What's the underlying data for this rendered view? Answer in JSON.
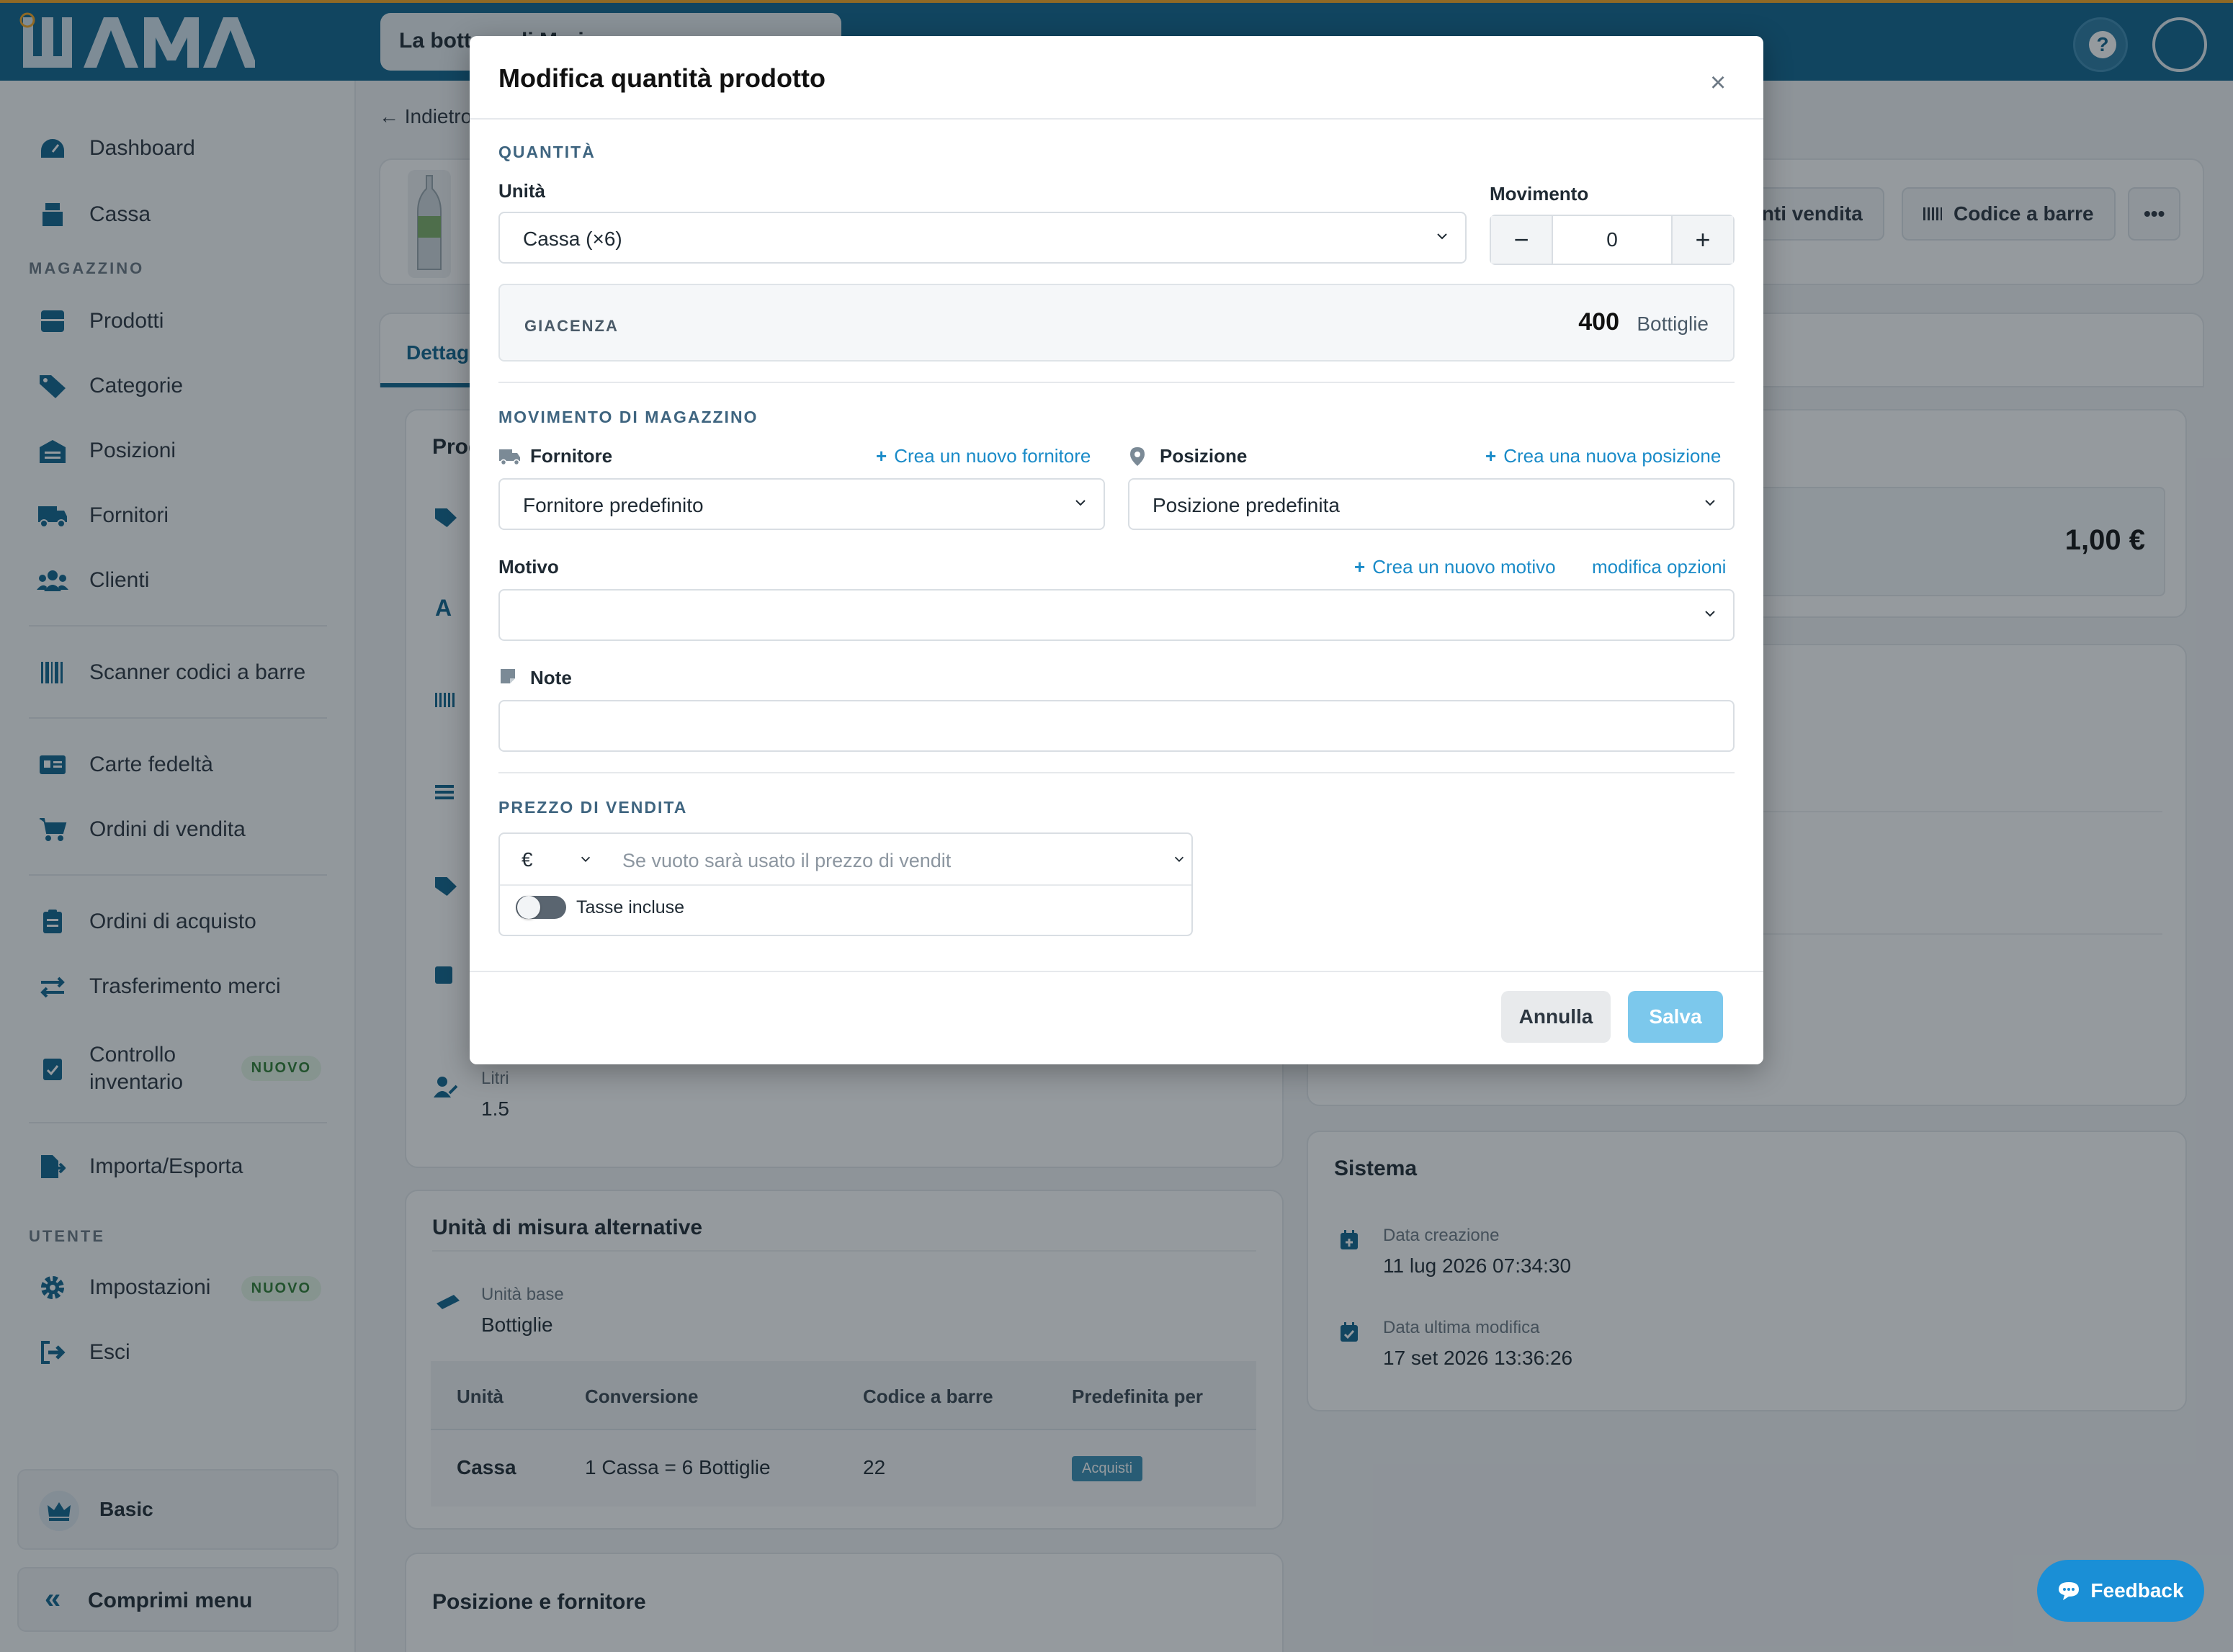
{
  "brand": {
    "logo_text": "WAMA",
    "accent": "#10648f",
    "highlight": "#f5a623"
  },
  "topbar": {
    "store_name": "La bottega di Mario"
  },
  "sidebar": {
    "items": [
      {
        "label": "Dashboard",
        "icon": "dashboard-icon"
      },
      {
        "label": "Cassa",
        "icon": "cash-register-icon"
      },
      {
        "label": "Prodotti",
        "icon": "box-icon"
      },
      {
        "label": "Categorie",
        "icon": "tags-icon"
      },
      {
        "label": "Posizioni",
        "icon": "warehouse-icon"
      },
      {
        "label": "Fornitori",
        "icon": "truck-icon"
      },
      {
        "label": "Clienti",
        "icon": "users-icon"
      },
      {
        "label": "Scanner codici a barre",
        "icon": "barcode-icon"
      },
      {
        "label": "Carte fedeltà",
        "icon": "id-card-icon"
      },
      {
        "label": "Ordini di vendita",
        "icon": "cart-icon"
      },
      {
        "label": "Ordini di acquisto",
        "icon": "clipboard-icon"
      },
      {
        "label": "Trasferimento merci",
        "icon": "transfer-icon"
      },
      {
        "label": "Controllo inventario",
        "icon": "clipboard-check-icon",
        "badge": "NUOVO"
      },
      {
        "label": "Importa/Esporta",
        "icon": "file-export-icon"
      },
      {
        "label": "Impostazioni",
        "icon": "gear-icon",
        "badge": "NUOVO"
      },
      {
        "label": "Esci",
        "icon": "sign-out-icon"
      }
    ],
    "section_magazzino": "MAGAZZINO",
    "section_utente": "UTENTE",
    "plan": "Basic",
    "collapse": "Comprimi menu"
  },
  "page": {
    "back": "Indietro",
    "header_buttons": {
      "sale_points": "Punti vendita",
      "barcode": "Codice a barre",
      "more": "•••"
    },
    "tab_details": "Dettagli",
    "card_product_title": "Prodotto",
    "price_value": "1,00 €",
    "liters_label": "Litri",
    "liters_value": "1.5",
    "alt_units": {
      "title": "Unità di misura alternative",
      "base_label": "Unità base",
      "base_value": "Bottiglie",
      "columns": [
        "Unità",
        "Conversione",
        "Codice a barre",
        "Predefinita per"
      ],
      "rows": [
        {
          "unit": "Cassa",
          "conversion": "1 Cassa = 6 Bottiglie",
          "barcode": "22",
          "default_for": "Acquisti"
        }
      ]
    },
    "position_card_title": "Posizione e fornitore",
    "system": {
      "title": "Sistema",
      "created_label": "Data creazione",
      "created_value": "11 lug 2026 07:34:30",
      "modified_label": "Data ultima modifica",
      "modified_value": "17 set 2026 13:36:26"
    },
    "feedback": "Feedback"
  },
  "modal": {
    "title": "Modifica quantità prodotto",
    "quantity_section": "QUANTITÀ",
    "unit_label": "Unità",
    "unit_value": "Cassa (×6)",
    "movement_label": "Movimento",
    "movement_value": "0",
    "stock_label": "GIACENZA",
    "stock_value": "400",
    "stock_unit": "Bottiglie",
    "warehouse_section": "MOVIMENTO DI MAGAZZINO",
    "supplier_label": "Fornitore",
    "supplier_link": "Crea un nuovo fornitore",
    "supplier_value": "Fornitore predefinito",
    "position_label": "Posizione",
    "position_link": "Crea una nuova posizione",
    "position_value": "Posizione predefinita",
    "reason_label": "Motivo",
    "reason_link": "Crea un nuovo motivo",
    "reason_edit_link": "modifica opzioni",
    "reason_value": "",
    "note_label": "Note",
    "note_value": "",
    "price_section": "PREZZO DI VENDITA",
    "currency": "€",
    "price_placeholder": "Se vuoto sarà usato il prezzo di vendit",
    "tax_label": "Tasse incluse",
    "tax_included": false,
    "cancel": "Annulla",
    "save": "Salva"
  }
}
